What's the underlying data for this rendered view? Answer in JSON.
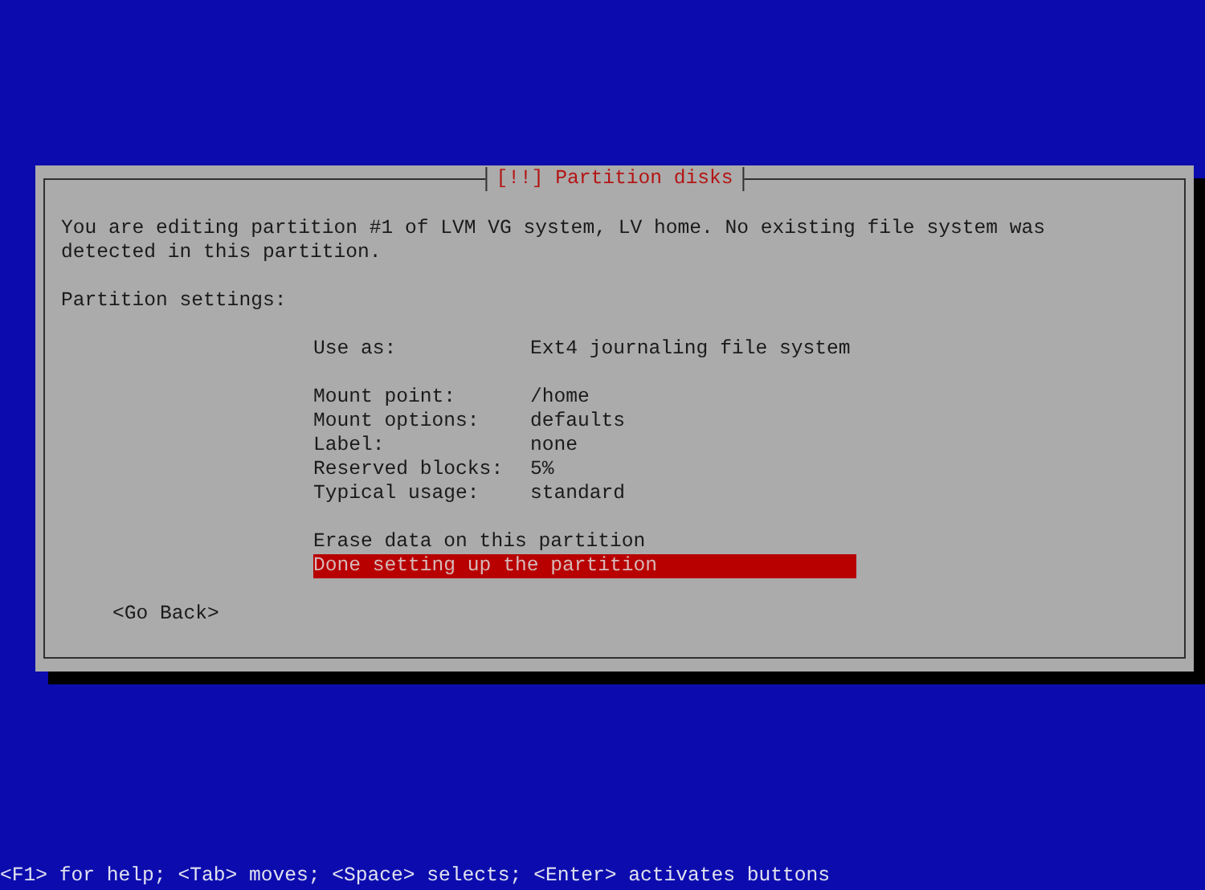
{
  "dialog": {
    "title": "[!!] Partition disks",
    "message": "You are editing partition #1 of LVM VG system, LV home. No existing file system was detected in this partition.",
    "section_heading": "Partition settings:",
    "groups": [
      {
        "items": [
          {
            "kind": "setting",
            "label": "Use as:",
            "value": "Ext4 journaling file system",
            "selected": false
          }
        ]
      },
      {
        "items": [
          {
            "kind": "setting",
            "label": "Mount point:",
            "value": "/home",
            "selected": false
          },
          {
            "kind": "setting",
            "label": "Mount options:",
            "value": "defaults",
            "selected": false
          },
          {
            "kind": "setting",
            "label": "Label:",
            "value": "none",
            "selected": false
          },
          {
            "kind": "setting",
            "label": "Reserved blocks:",
            "value": "5%",
            "selected": false
          },
          {
            "kind": "setting",
            "label": "Typical usage:",
            "value": "standard",
            "selected": false
          }
        ]
      },
      {
        "items": [
          {
            "kind": "action",
            "label": "Erase data on this partition",
            "selected": false
          },
          {
            "kind": "action",
            "label": "Done setting up the partition",
            "selected": true
          }
        ]
      }
    ],
    "back_button": "<Go Back>"
  },
  "status_bar": "<F1> for help; <Tab> moves; <Space> selects; <Enter> activates buttons"
}
